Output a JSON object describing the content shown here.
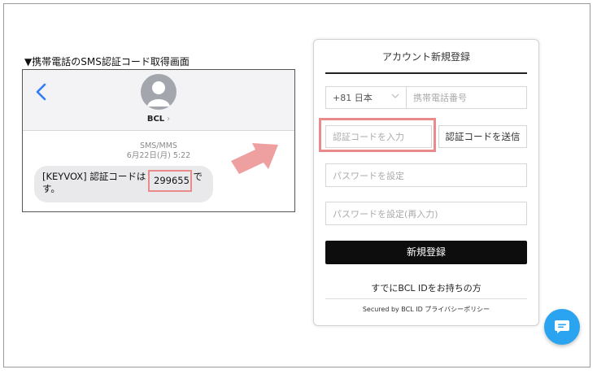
{
  "caption": "▼携帯電話のSMS認証コード取得画面",
  "sms": {
    "contact_name": "BCL",
    "contact_chevron": "›",
    "meta_line1": "SMS/MMS",
    "meta_line2": "6月22日(月) 5:22",
    "message_prefix": "[KEYVOX] 認証コードは",
    "message_code": "299655",
    "message_suffix_line1": "で",
    "message_suffix_line2": "す。"
  },
  "signup": {
    "title": "アカウント新規登録",
    "country_value": "+81 日本",
    "phone_placeholder": "携帯電話番号",
    "code_placeholder": "認証コードを入力",
    "send_code_label": "認証コードを送信",
    "password_placeholder": "パスワードを設定",
    "password_confirm_placeholder": "パスワードを設定(再入力)",
    "submit_label": "新規登録",
    "already_label": "すでにBCL IDをお持ちの方",
    "secured_label": "Secured by BCL ID プライバシーポリシー"
  },
  "colors": {
    "highlight": "#e98b8b",
    "ios_blue": "#2f7cf6",
    "chat_blue": "#2aa3f0"
  },
  "icons": {
    "back": "chevron-left-icon",
    "avatar": "person-avatar-icon",
    "arrow": "arrow-right-icon",
    "chat": "chat-bubble-icon",
    "dropdown": "chevron-down-icon"
  }
}
